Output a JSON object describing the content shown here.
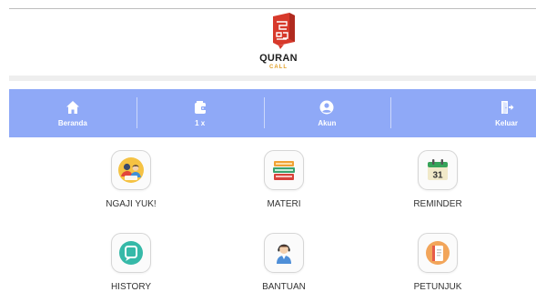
{
  "app": {
    "logo_title": "QURAN",
    "logo_subtitle": "CALL",
    "logo_colors": {
      "red": "#d7392b",
      "gold": "#e0a02a"
    }
  },
  "navbar": {
    "background": "#8fa9f7",
    "items": [
      {
        "label": "Beranda",
        "icon": "home-icon"
      },
      {
        "label": "1 x",
        "icon": "wallet-icon"
      },
      {
        "label": "Akun",
        "icon": "account-icon"
      },
      {
        "label": "Keluar",
        "icon": "logout-icon"
      }
    ]
  },
  "menu": {
    "items": [
      {
        "label": "NGAJI YUK!",
        "icon": "study-group-icon"
      },
      {
        "label": "MATERI",
        "icon": "books-icon"
      },
      {
        "label": "REMINDER",
        "icon": "calendar-icon"
      },
      {
        "label": "HISTORY",
        "icon": "chat-history-icon"
      },
      {
        "label": "BANTUAN",
        "icon": "support-agent-icon"
      },
      {
        "label": "PETUNJUK",
        "icon": "guide-book-icon"
      }
    ]
  }
}
